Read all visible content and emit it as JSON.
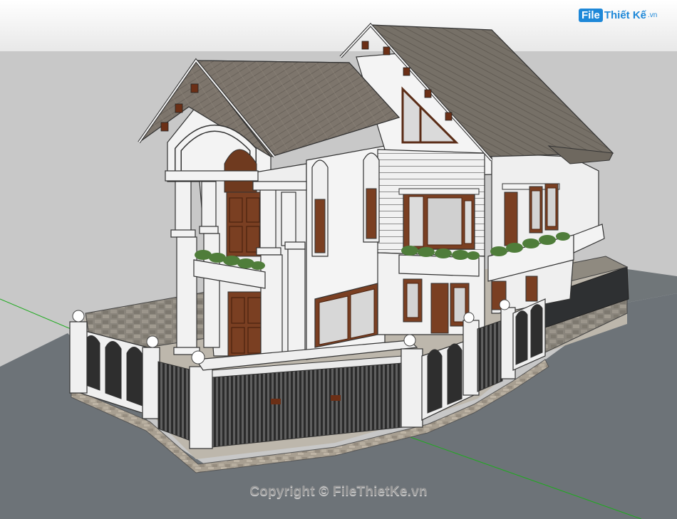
{
  "watermark": {
    "logo_badge": "File",
    "logo_text": "Thiết Kế",
    "logo_tld": ".vn",
    "copyright": "Copyright © FileThietKe.vn"
  },
  "colors": {
    "sky": "#ffffff",
    "horizon_band": "#e3e3e3",
    "ground": "#c9c9c9",
    "road": "#6f757a",
    "roof": "#7c746b",
    "wall": "#f4f4f4",
    "wood": "#7a3f22",
    "stone": "#8e8a82",
    "plants": "#4f7d3a"
  }
}
